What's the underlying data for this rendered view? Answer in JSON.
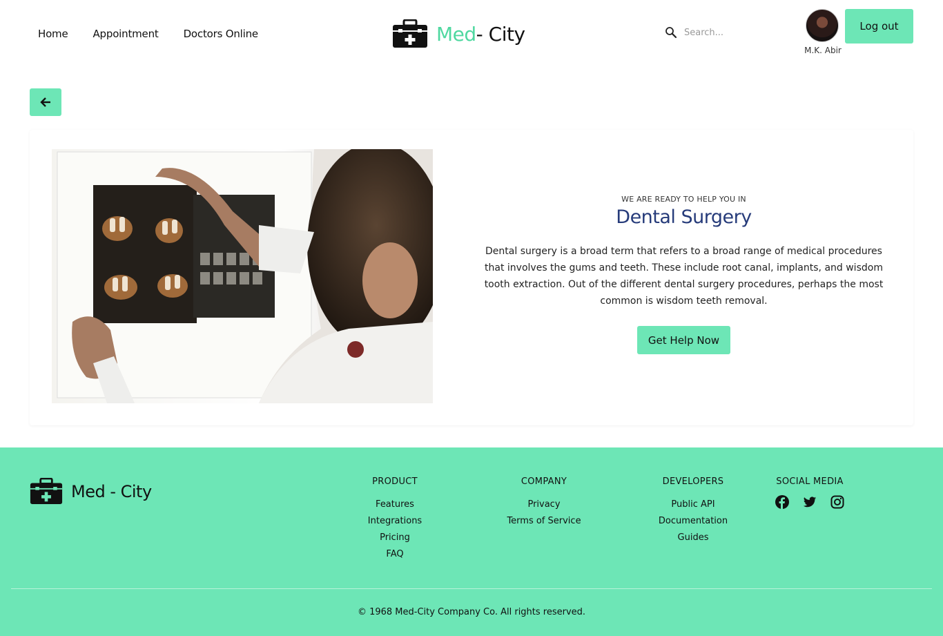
{
  "nav": {
    "items": [
      "Home",
      "Appointment",
      "Doctors Online"
    ]
  },
  "brand": {
    "part1": "Med",
    "part2": "- City"
  },
  "search": {
    "placeholder": "Search..."
  },
  "user": {
    "name": "M.K. Abir"
  },
  "header": {
    "logout_label": "Log out"
  },
  "service": {
    "kicker": "WE ARE READY TO HELP YOU IN",
    "title": "Dental Surgery",
    "description": "Dental surgery is a broad term that refers to a broad range of medical procedures that involves the gums and teeth. These include root canal, implants, and wisdom tooth extraction. Out of the different dental surgery procedures, perhaps the most common is wisdom teeth removal.",
    "cta_label": "Get Help Now"
  },
  "footer": {
    "brand": "Med - City",
    "columns": [
      {
        "title": "PRODUCT",
        "links": [
          "Features",
          "Integrations",
          "Pricing",
          "FAQ"
        ]
      },
      {
        "title": "COMPANY",
        "links": [
          "Privacy",
          "Terms of Service"
        ]
      },
      {
        "title": "DEVELOPERS",
        "links": [
          "Public API",
          "Documentation",
          "Guides"
        ]
      }
    ],
    "social_title": "SOCIAL MEDIA",
    "social_icons": [
      "facebook-icon",
      "twitter-icon",
      "instagram-icon"
    ],
    "copyright": "© 1968 Med-City Company Co. All rights reserved."
  },
  "colors": {
    "accent": "#6de6b6",
    "brand_green": "#4fd8a0",
    "title_blue": "#263b7a"
  }
}
